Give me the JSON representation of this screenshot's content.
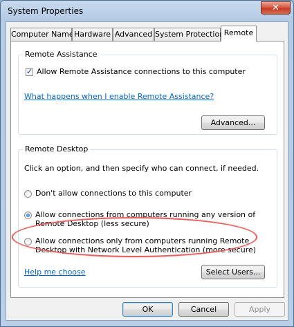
{
  "window": {
    "title": "System Properties",
    "close_glyph": "✕"
  },
  "tabs": [
    {
      "label": "Computer Name",
      "active": false
    },
    {
      "label": "Hardware",
      "active": false
    },
    {
      "label": "Advanced",
      "active": false
    },
    {
      "label": "System Protection",
      "active": false
    },
    {
      "label": "Remote",
      "active": true
    }
  ],
  "remote_assistance": {
    "group_title": "Remote Assistance",
    "allow_label": "Allow Remote Assistance connections to this computer",
    "allow_checked": true,
    "help_link": "What happens when I enable Remote Assistance?",
    "advanced_button": "Advanced..."
  },
  "remote_desktop": {
    "group_title": "Remote Desktop",
    "instruction": "Click an option, and then specify who can connect, if needed.",
    "options": [
      {
        "line1": "Don't allow connections to this computer",
        "line2": "",
        "selected": false
      },
      {
        "line1": "Allow connections from computers running any version of",
        "line2": "Remote Desktop (less secure)",
        "selected": true
      },
      {
        "line1": "Allow connections only from computers running Remote",
        "line2": "Desktop with Network Level Authentication (more secure)",
        "selected": false
      }
    ],
    "help_link": "Help me choose",
    "select_users_button": "Select Users..."
  },
  "footer": {
    "ok": "OK",
    "cancel": "Cancel",
    "apply": "Apply",
    "apply_enabled": false
  },
  "colors": {
    "link": "#0066cc",
    "highlight_ellipse": "#e06060",
    "title_bar": "#b5cbe4"
  }
}
